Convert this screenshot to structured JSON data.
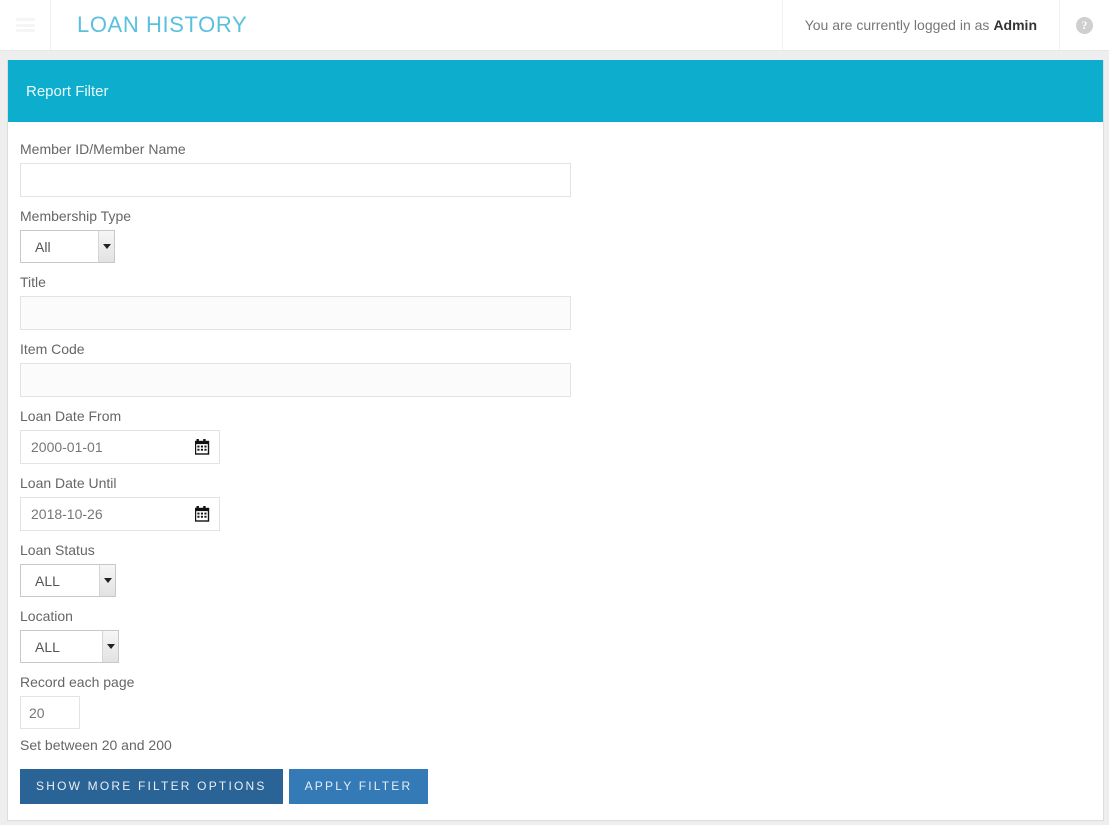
{
  "navbar": {
    "menu_icon": "hamburger-icon",
    "title": "LOAN HISTORY",
    "logged_in_prefix": "You are currently logged in as",
    "username": "Admin",
    "help_icon": "question-circle-icon",
    "title_color": "#5bc0de"
  },
  "panel": {
    "heading": "Report Filter",
    "heading_bg": "#0cadcd"
  },
  "form": {
    "member": {
      "label": "Member ID/Member Name",
      "value": "",
      "placeholder": ""
    },
    "membership_type": {
      "label": "Membership Type",
      "value": "All",
      "options": [
        "All"
      ]
    },
    "title_field": {
      "label": "Title",
      "value": "",
      "placeholder": ""
    },
    "item_code": {
      "label": "Item Code",
      "value": "",
      "placeholder": ""
    },
    "loan_date_from": {
      "label": "Loan Date From",
      "value": "2000-01-01",
      "icon": "calendar-icon"
    },
    "loan_date_until": {
      "label": "Loan Date Until",
      "value": "2018-10-26",
      "icon": "calendar-icon"
    },
    "loan_status": {
      "label": "Loan Status",
      "value": "ALL",
      "options": [
        "ALL"
      ]
    },
    "location": {
      "label": "Location",
      "value": "ALL",
      "options": [
        "ALL"
      ]
    },
    "record_each_page": {
      "label": "Record each page",
      "value": "20",
      "help": "Set between 20 and 200"
    }
  },
  "buttons": {
    "show_more": "Show More Filter Options",
    "apply_filter": "Apply Filter",
    "show_more_color": "#2a6496",
    "apply_filter_color": "#337ab7"
  }
}
